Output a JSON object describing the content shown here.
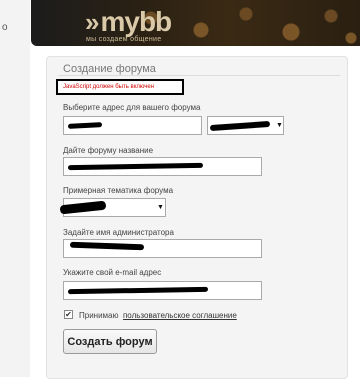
{
  "header": {
    "logo_text": "mybb",
    "logo_chevrons": "»",
    "tagline": "мы создаем общение"
  },
  "form": {
    "title": "Создание форума",
    "js_warning": "JavaScript должен быть включен",
    "address_label": "Выберите адрес для вашего форума",
    "name_label": "Дайте форуму название",
    "topic_label": "Примерная тематика форума",
    "admin_label": "Задайте имя администратора",
    "email_label": "Укажите свой e-mail адрес",
    "agree_text": "Принимаю",
    "agree_link": "пользовательское соглашение",
    "agree_checked": true,
    "checkmark": "✔",
    "submit_label": "Создать форум",
    "dropdown_arrow": "▼"
  },
  "colors": {
    "warning_text": "#d30000",
    "panel_bg": "#f4f4f4"
  }
}
